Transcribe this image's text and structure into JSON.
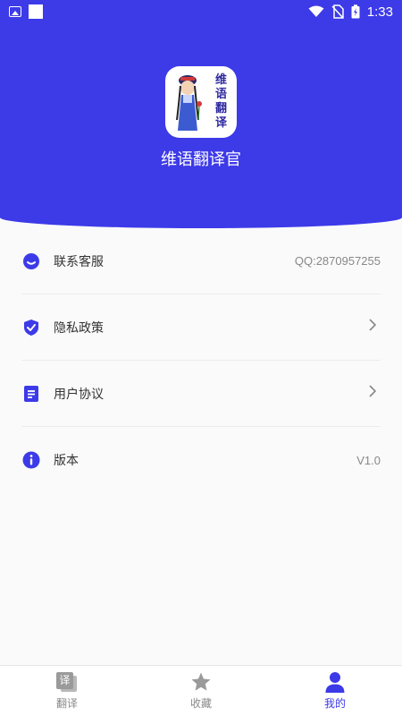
{
  "status_bar": {
    "time": "1:33"
  },
  "header": {
    "logo_text": "维语翻译",
    "app_name": "维语翻译官"
  },
  "menu": {
    "items": [
      {
        "label": "联系客服",
        "value": "QQ:2870957255",
        "icon": "contact-service-icon"
      },
      {
        "label": "隐私政策",
        "value": "",
        "icon": "shield-check-icon"
      },
      {
        "label": "用户协议",
        "value": "",
        "icon": "document-icon"
      },
      {
        "label": "版本",
        "value": "V1.0",
        "icon": "info-icon"
      }
    ]
  },
  "tabbar": {
    "items": [
      {
        "label": "翻译",
        "icon_text": "译",
        "active": false
      },
      {
        "label": "收藏",
        "active": false
      },
      {
        "label": "我的",
        "active": true
      }
    ]
  },
  "colors": {
    "accent": "#3d3ae8",
    "inactive": "#9a9a9a"
  }
}
